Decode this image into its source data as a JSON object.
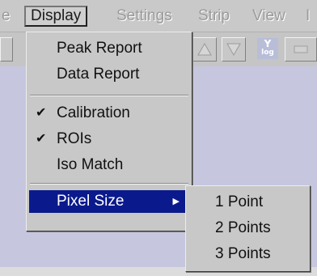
{
  "menubar": {
    "items": [
      {
        "label": "e",
        "state": "disabled"
      },
      {
        "label": "Display",
        "state": "open"
      },
      {
        "label": "Settings",
        "state": "disabled"
      },
      {
        "label": "Strip",
        "state": "disabled"
      },
      {
        "label": "View",
        "state": "disabled"
      },
      {
        "label": "I",
        "state": "disabled"
      }
    ]
  },
  "toolbar": {
    "ylog_button": {
      "line1": "Y",
      "line2": "log"
    },
    "icons": [
      "triangle-up-icon",
      "triangle-down-icon",
      "ylog-icon",
      "partial-icon"
    ]
  },
  "display_menu": {
    "items": [
      {
        "label": "Peak Report",
        "checked": false
      },
      {
        "label": "Data Report",
        "checked": false
      },
      {
        "label": "Calibration",
        "checked": true
      },
      {
        "label": "ROIs",
        "checked": true
      },
      {
        "label": "Iso Match",
        "checked": false
      },
      {
        "label": "Pixel Size",
        "checked": false,
        "has_submenu": true,
        "selected": true
      }
    ],
    "check_glyph": "✔",
    "submenu_arrow": "▶"
  },
  "pixel_size_submenu": {
    "items": [
      {
        "label": "1 Point"
      },
      {
        "label": "2 Points"
      },
      {
        "label": "3 Points"
      }
    ]
  },
  "colors": {
    "menu_highlight": "#0a1a8c",
    "workspace": "#c6c6df",
    "menu_face": "#c8c8c8"
  }
}
